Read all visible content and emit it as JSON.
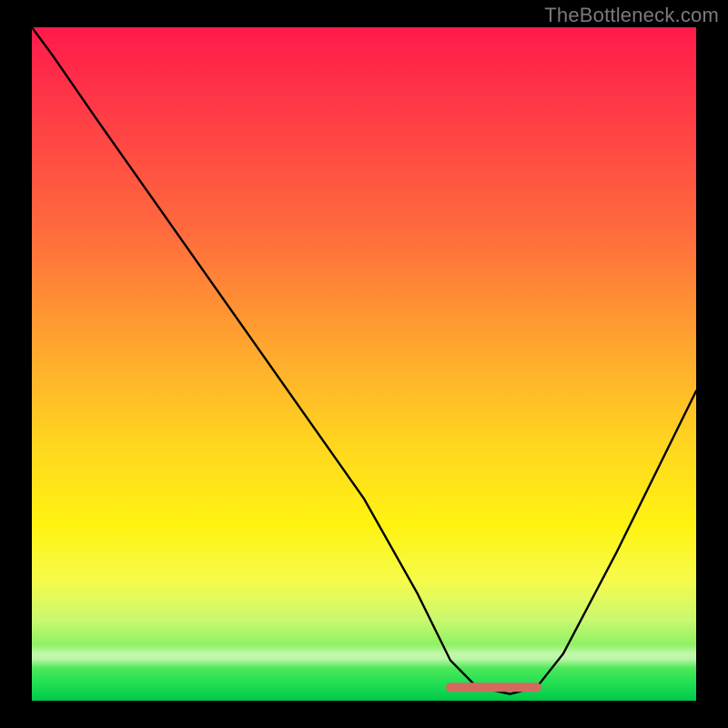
{
  "watermark": "TheBottleneck.com",
  "chart_data": {
    "type": "line",
    "title": "",
    "xlabel": "",
    "ylabel": "",
    "xlim": [
      0,
      100
    ],
    "ylim": [
      0,
      100
    ],
    "grid": false,
    "series": [
      {
        "name": "curve",
        "color": "#000000",
        "x": [
          0,
          3,
          10,
          20,
          30,
          40,
          50,
          58,
          63,
          67,
          72,
          76,
          80,
          88,
          100
        ],
        "y": [
          100,
          96,
          86,
          72,
          58,
          44,
          30,
          16,
          6,
          2,
          1,
          2,
          7,
          22,
          46
        ]
      }
    ],
    "trough_highlight": {
      "name": "bottom-band",
      "color": "#d46a5f",
      "x": [
        63,
        76
      ],
      "y": [
        2,
        2
      ]
    },
    "gradient_stops": [
      {
        "pos": 0.0,
        "color": "#ff1a4b"
      },
      {
        "pos": 0.3,
        "color": "#ff6a3d"
      },
      {
        "pos": 0.62,
        "color": "#ffd61f"
      },
      {
        "pos": 0.82,
        "color": "#f6fb4a"
      },
      {
        "pos": 1.0,
        "color": "#00c94a"
      }
    ]
  }
}
